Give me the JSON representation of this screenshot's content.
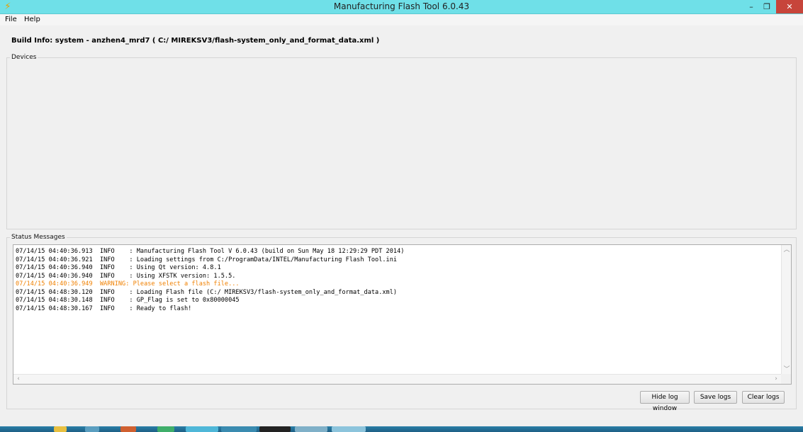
{
  "window": {
    "title": "Manufacturing Flash Tool 6.0.43",
    "app_icon": "lightning-bolt-icon",
    "controls": {
      "minimize": "–",
      "maximize": "❐",
      "close": "✕"
    }
  },
  "menu": {
    "file": "File",
    "help": "Help"
  },
  "build_info": "Build Info:  system - anzhen4_mrd7 ( C:/ MIREKSV3/flash-system_only_and_format_data.xml )",
  "devices_group": {
    "title": "Devices"
  },
  "status_group": {
    "title": "Status Messages"
  },
  "log": {
    "lines": [
      {
        "text": "07/14/15 04:40:36.913  INFO    : Manufacturing Flash Tool V 6.0.43 (build on Sun May 18 12:29:29 PDT 2014)",
        "level": "info"
      },
      {
        "text": "07/14/15 04:40:36.921  INFO    : Loading settings from C:/ProgramData/INTEL/Manufacturing Flash Tool.ini",
        "level": "info"
      },
      {
        "text": "07/14/15 04:40:36.940  INFO    : Using Qt version: 4.8.1",
        "level": "info"
      },
      {
        "text": "07/14/15 04:40:36.940  INFO    : Using XFSTK version: 1.5.5.",
        "level": "info"
      },
      {
        "text": "07/14/15 04:40:36.949  WARNING: Please select a flash file...",
        "level": "warning"
      },
      {
        "text": "07/14/15 04:48:30.120  INFO    : Loading Flash file (C:/ MIREKSV3/flash-system_only_and_format_data.xml)",
        "level": "info"
      },
      {
        "text": "07/14/15 04:48:30.148  INFO    : GP_Flag is set to 0x80000045",
        "level": "info"
      },
      {
        "text": "07/14/15 04:48:30.167  INFO    : Ready to flash!",
        "level": "info"
      }
    ],
    "warning_color": "#f08000"
  },
  "buttons": {
    "hide_log": "Hide log window",
    "save_logs": "Save logs",
    "clear_logs": "Clear logs"
  },
  "colors": {
    "titlebar": "#6fe0e8",
    "close_button": "#c7453b",
    "taskbar": "#1d5f85"
  }
}
